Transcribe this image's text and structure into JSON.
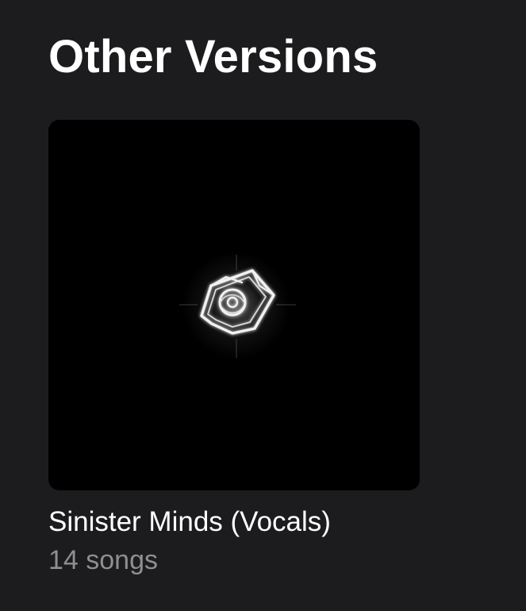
{
  "section": {
    "title": "Other Versions"
  },
  "album": {
    "title": "Sinister Minds (Vocals)",
    "meta": "14 songs",
    "artwork_icon": "crystal-emblem-icon"
  },
  "colors": {
    "background": "#1c1c1e",
    "title": "#ffffff",
    "secondary_text": "#8e8e93",
    "artwork_background": "#000000"
  }
}
